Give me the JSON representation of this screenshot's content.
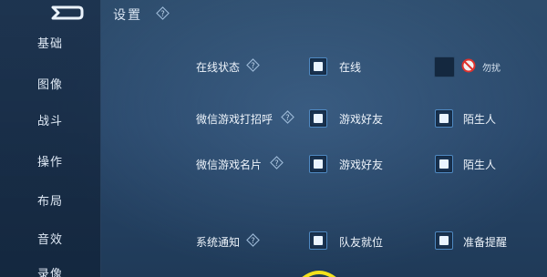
{
  "header": {
    "title": "设置"
  },
  "sidebar": {
    "items": [
      {
        "label": "基础"
      },
      {
        "label": "图像"
      },
      {
        "label": "战斗"
      },
      {
        "label": "操作"
      },
      {
        "label": "布局"
      },
      {
        "label": "音效"
      },
      {
        "label": "录像"
      }
    ]
  },
  "settings": {
    "online_status": {
      "label": "在线状态",
      "option_online": {
        "label": "在线",
        "checked": true
      },
      "option_dnd": {
        "label": "勿扰",
        "checked": false
      }
    },
    "wechat_greeting": {
      "label": "微信游戏打招呼",
      "option_friends": {
        "label": "游戏好友",
        "checked": true
      },
      "option_strangers": {
        "label": "陌生人",
        "checked": true
      }
    },
    "wechat_card": {
      "label": "微信游戏名片",
      "option_friends": {
        "label": "游戏好友",
        "checked": true
      },
      "option_strangers": {
        "label": "陌生人",
        "checked": true
      }
    },
    "system_notify": {
      "label": "系统通知",
      "option_team_ready": {
        "label": "队友就位",
        "checked": true
      },
      "option_prepare": {
        "label": "准备提醒",
        "checked": true
      }
    }
  },
  "icons": {
    "help": "question-diamond-icon",
    "back": "back-arrow-icon",
    "dnd": "no-entry-icon"
  },
  "colors": {
    "background": "#29476a",
    "checkbox_border": "#4f89c2",
    "highlight_ring": "#f4e21c",
    "dnd_red": "#e0322d"
  }
}
